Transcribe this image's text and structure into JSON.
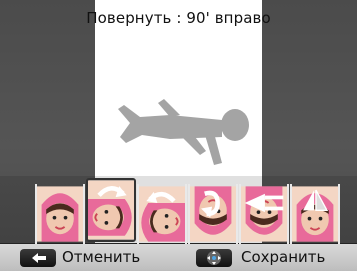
{
  "header": {
    "title": "Повернуть : 90' вправо"
  },
  "effects": [
    {
      "name": "rotate-right",
      "selected": false,
      "icon": "rotate-cw-arrow-icon"
    },
    {
      "name": "rotate-right-90",
      "selected": true,
      "icon": "rotate-cw-arrow-icon"
    },
    {
      "name": "rotate-left-90",
      "selected": false,
      "icon": "rotate-ccw-arrow-icon"
    },
    {
      "name": "rotate-180",
      "selected": false,
      "icon": "rotate-180-arrow-icon"
    },
    {
      "name": "flip-vertical",
      "selected": false,
      "icon": "flip-vertical-icon"
    },
    {
      "name": "flip-horizontal",
      "selected": false,
      "icon": "flip-horizontal-icon"
    }
  ],
  "footer": {
    "cancel_label": "Отменить",
    "cancel_icon": "back-arrow-icon",
    "save_label": "Сохранить",
    "save_icon": "dpad-icon"
  },
  "colors": {
    "accent_pink": "#e85c8a",
    "skin": "#f0c8b0",
    "hair": "#4a2a1e"
  }
}
